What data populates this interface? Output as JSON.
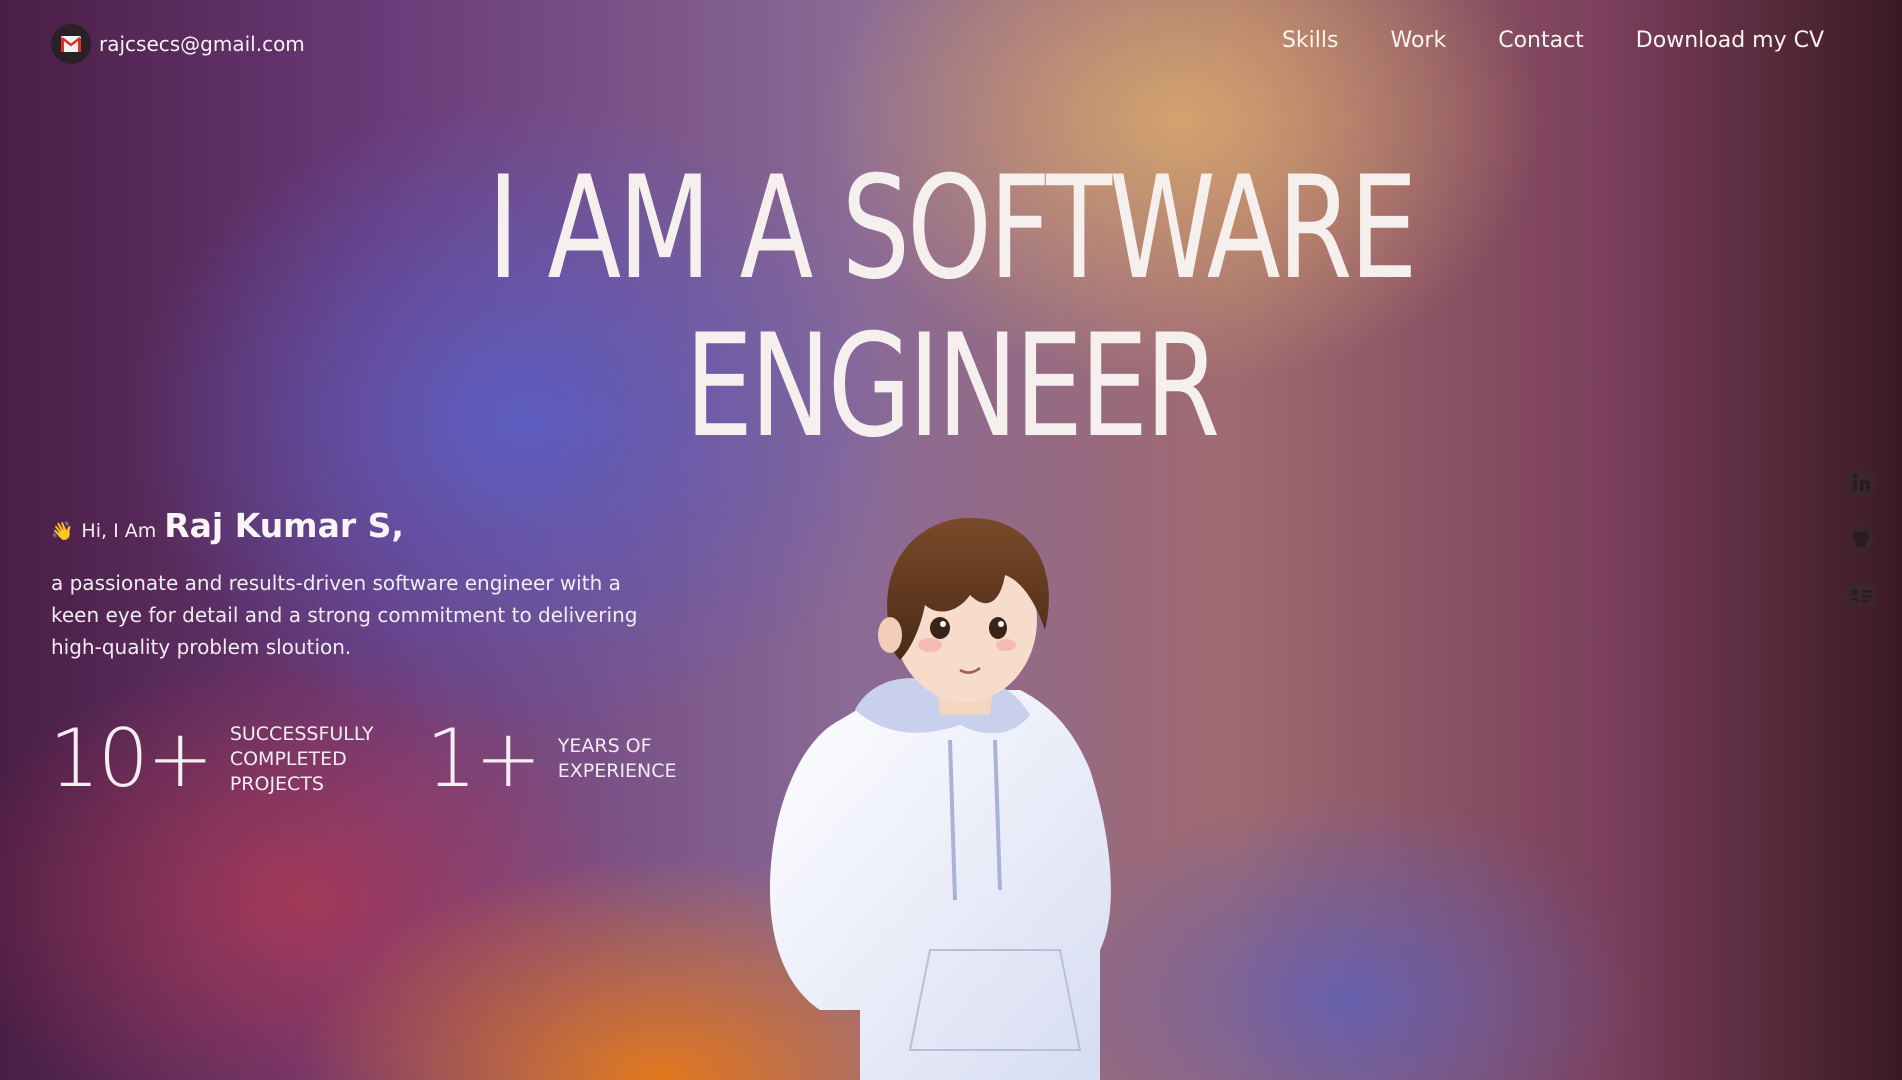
{
  "header": {
    "email": "rajcsecs@gmail.com",
    "email_icon": "gmail-icon",
    "nav": [
      {
        "label": "Skills"
      },
      {
        "label": "Work"
      },
      {
        "label": "Contact"
      },
      {
        "label": "Download my CV"
      }
    ]
  },
  "hero": {
    "headline_line1": "I AM A SOFTWARE",
    "headline_line2": "ENGINEER"
  },
  "intro": {
    "wave_emoji": "👋",
    "greeting": "Hi, I Am",
    "name": "Raj Kumar S,",
    "bio": "a passionate and results-driven software engineer with a keen eye for detail and a strong commitment to delivering high-quality problem sloution."
  },
  "stats": [
    {
      "value": "10+",
      "label": "Successfully completed projects"
    },
    {
      "value": "1+",
      "label": "Years of experience"
    }
  ],
  "socials": [
    {
      "icon": "linkedin-icon"
    },
    {
      "icon": "github-icon"
    },
    {
      "icon": "resume-card-icon"
    }
  ],
  "colors": {
    "text": "#f5efee",
    "badge_bg": "#2a2028",
    "gmail_red": "#d93025"
  }
}
